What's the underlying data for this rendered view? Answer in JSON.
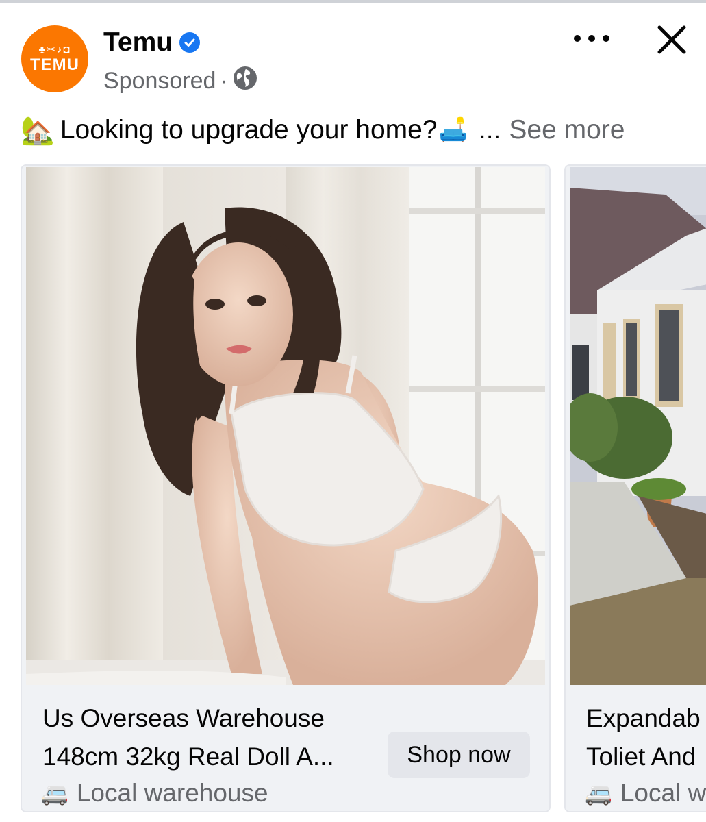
{
  "post": {
    "page_name": "Temu",
    "avatar_text": "TEMU",
    "sponsored_label": "Sponsored",
    "separator": "·",
    "caption_text": "Looking to upgrade your home?",
    "caption_emoji_start": "🏡",
    "caption_emoji_end": "🛋️",
    "caption_ellipsis": "...",
    "see_more_label": "See more",
    "verified_icon": "verified-badge-icon",
    "audience_icon": "globe-icon"
  },
  "carousel": {
    "cards": [
      {
        "title_line1": "Us Overseas Warehouse",
        "title_line2": "148cm 32kg Real Doll A...",
        "source_icon": "🚐",
        "source_text": "Local warehouse",
        "cta_label": "Shop now"
      },
      {
        "title_line1": "Expandab",
        "title_line2": "Toliet And",
        "source_icon": "🚐",
        "source_text": "Local w"
      }
    ]
  },
  "colors": {
    "brand_orange": "#fb7701",
    "verified_blue": "#1877f2",
    "secondary_text": "#65676b",
    "button_gray": "#e4e6eb",
    "card_bg": "#f0f2f5"
  }
}
